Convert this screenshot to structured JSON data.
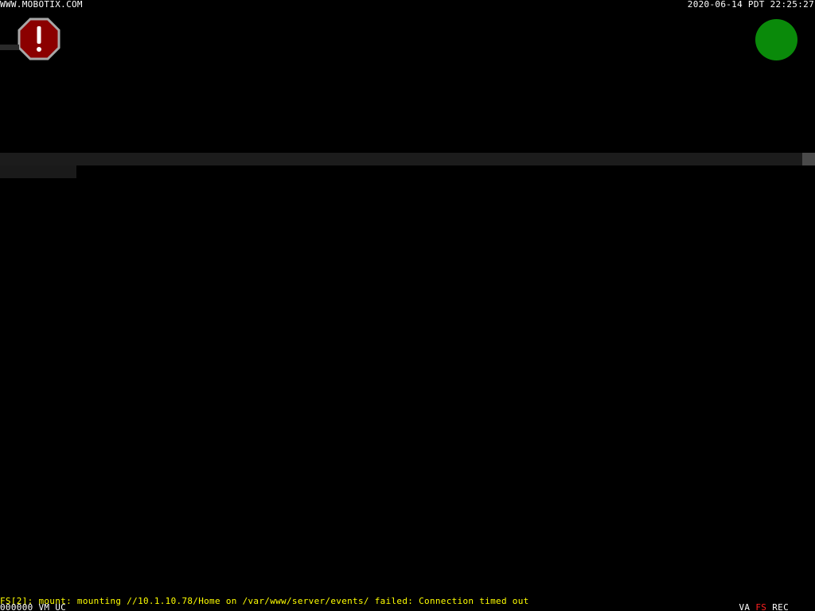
{
  "overlay": {
    "brand": "WWW.MOBOTIX.COM",
    "timestamp": "2020-06-14 PDT 22:25:27",
    "error_message": "FS[2]: mount: mounting //10.1.10.78/Home on /var/www/server/events/ failed: Connection timed out",
    "counter": "000000 VM UC",
    "flags": [
      {
        "label": "VA",
        "color": "#ffffff"
      },
      {
        "label": "FS",
        "color": "#ff2020"
      },
      {
        "label": "REC",
        "color": "#ffffff"
      }
    ]
  },
  "icons": {
    "alarm": {
      "name": "exclamation-stop-icon",
      "fill": "#8b0000",
      "stroke": "#a8a8a8",
      "glyph_color": "#ffffff"
    },
    "status": {
      "name": "status-dot-icon",
      "fill": "#0a8a0a"
    }
  },
  "colors": {
    "background": "#000000",
    "error_text": "#ffff00",
    "overlay_text": "#ffffff"
  }
}
